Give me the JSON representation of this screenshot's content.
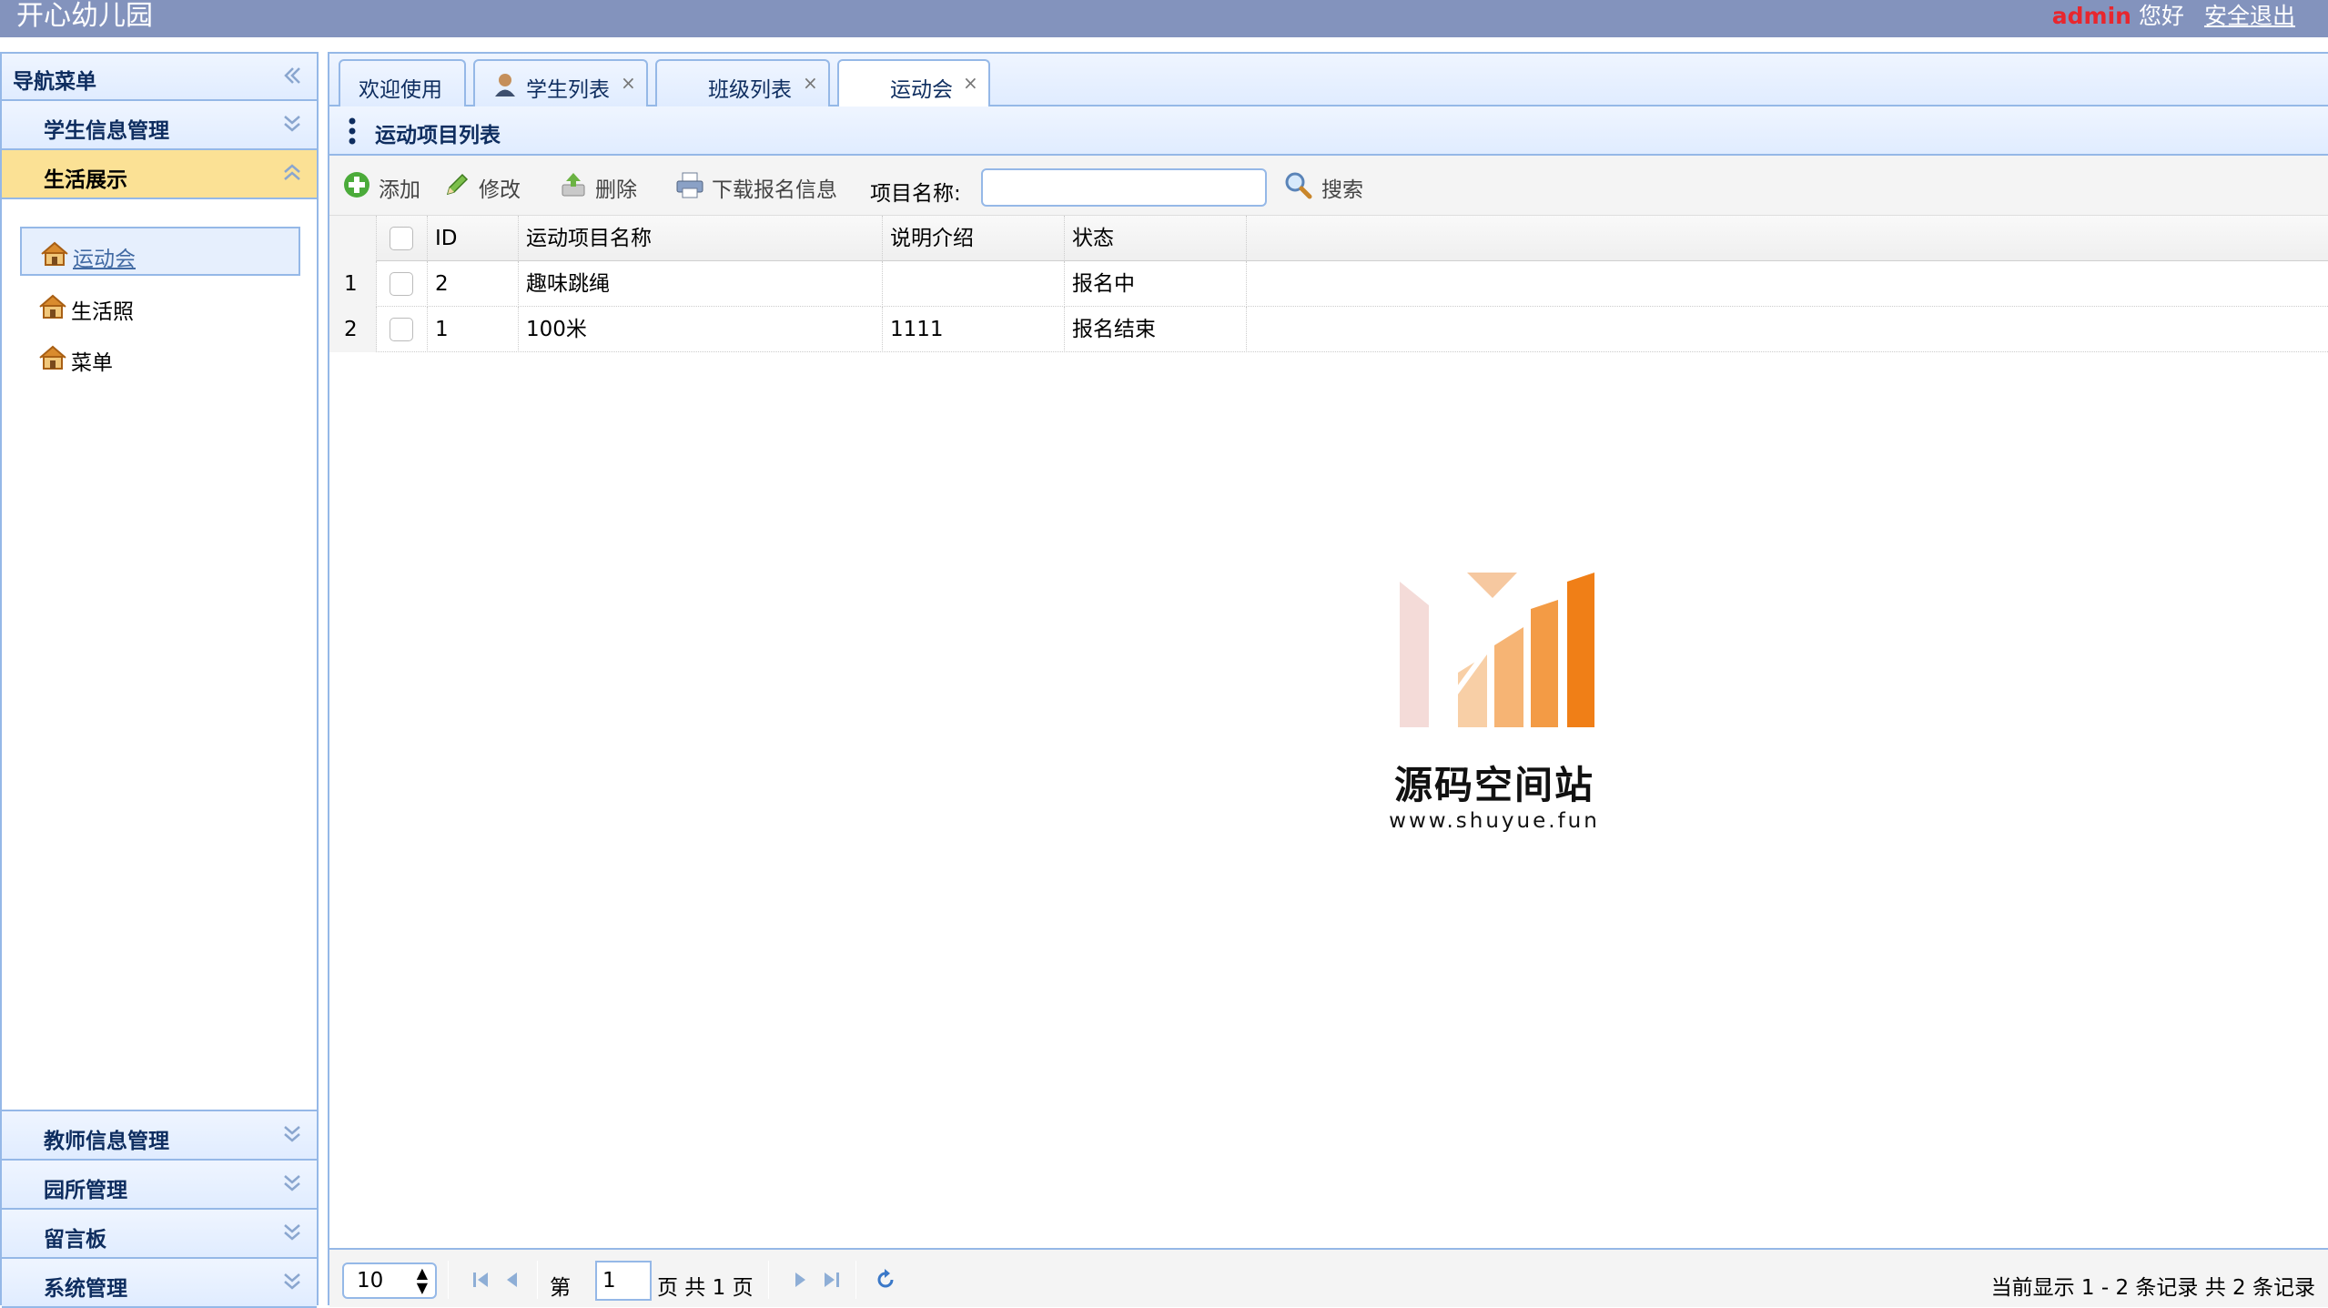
{
  "app": {
    "title": "开心幼儿园"
  },
  "topbar": {
    "user": "admin",
    "greeting": "您好",
    "logout": "安全退出"
  },
  "nav": {
    "title": "导航菜单",
    "sections_top": [
      {
        "label": "学生信息管理",
        "active": false
      },
      {
        "label": "生活展示",
        "active": true
      }
    ],
    "items": [
      {
        "label": "运动会",
        "selected": true,
        "icon": "house-icon"
      },
      {
        "label": "生活照",
        "selected": false,
        "icon": "house-icon"
      },
      {
        "label": "菜单",
        "selected": false,
        "icon": "house-icon"
      }
    ],
    "sections_bottom": [
      {
        "label": "教师信息管理"
      },
      {
        "label": "园所管理"
      },
      {
        "label": "留言板"
      },
      {
        "label": "系统管理"
      }
    ]
  },
  "tabs": [
    {
      "label": "欢迎使用",
      "closable": false,
      "active": false
    },
    {
      "label": "学生列表",
      "closable": true,
      "active": false,
      "icon": "student-icon"
    },
    {
      "label": "班级列表",
      "closable": true,
      "active": false
    },
    {
      "label": "运动会",
      "closable": true,
      "active": true
    }
  ],
  "tab_close_glyph": "×",
  "panel": {
    "title": "运动项目列表"
  },
  "toolbar": {
    "add": "添加",
    "edit": "修改",
    "delete": "删除",
    "download": "下载报名信息",
    "search_label": "项目名称:",
    "search_value": "",
    "search_button": "搜索"
  },
  "grid": {
    "columns": [
      "ID",
      "运动项目名称",
      "说明介绍",
      "状态"
    ],
    "rows": [
      {
        "num": "1",
        "id": "2",
        "name": "趣味跳绳",
        "desc": "",
        "status": "报名中"
      },
      {
        "num": "2",
        "id": "1",
        "name": "100米",
        "desc": "1111",
        "status": "报名结束"
      }
    ]
  },
  "watermark": {
    "name": "源码空间站",
    "url": "www.shuyue.fun"
  },
  "pager": {
    "page_size": "10",
    "page_prefix": "第",
    "page": "1",
    "page_suffix": "页 共 1 页",
    "info": "当前显示 1 - 2 条记录 共 2 条记录"
  },
  "colors": {
    "topbar": "#8393bd",
    "border": "#95b8e7",
    "active_section": "#fbe195",
    "admin_text": "#e8262d"
  }
}
